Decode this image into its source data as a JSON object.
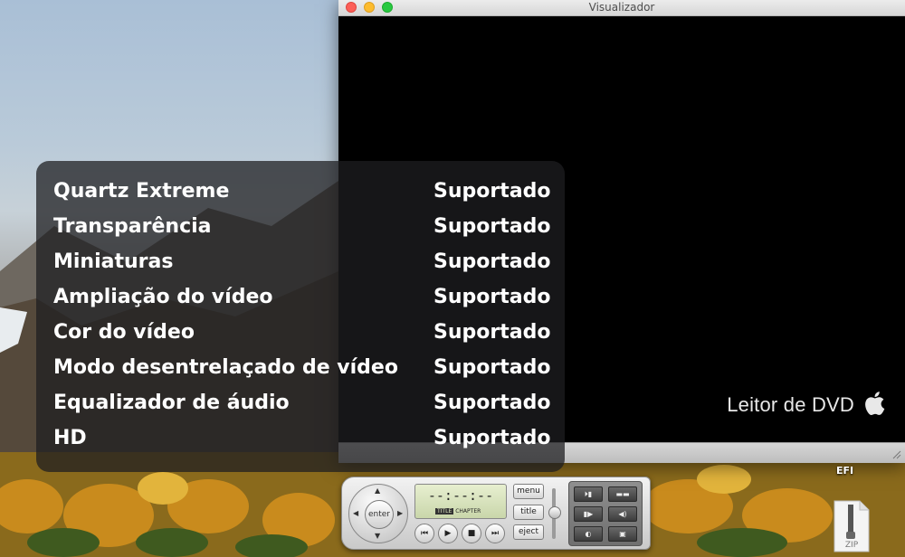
{
  "window": {
    "title": "Visualizador",
    "brand": "Leitor de DVD"
  },
  "capabilities": {
    "rows": [
      {
        "name": "Quartz Extreme",
        "status": "Suportado"
      },
      {
        "name": "Transparência",
        "status": "Suportado"
      },
      {
        "name": "Miniaturas",
        "status": "Suportado"
      },
      {
        "name": "Ampliação do vídeo",
        "status": "Suportado"
      },
      {
        "name": "Cor do vídeo",
        "status": "Suportado"
      },
      {
        "name": "Modo desentrelaçado de vídeo",
        "status": "Suportado"
      },
      {
        "name": "Equalizador de áudio",
        "status": "Suportado"
      },
      {
        "name": "HD",
        "status": "Suportado"
      }
    ]
  },
  "desktop": {
    "efi_label": "EFI",
    "zip_label": "ZIP"
  },
  "controller": {
    "enter_label": "enter",
    "time_display": "--:--:--",
    "title_tag": "TITLE",
    "chapter_tag": "CHAPTER",
    "menu_label": "menu",
    "title_label": "title",
    "eject_label": "eject"
  },
  "colors": {
    "close": "#fc5f57",
    "minimize": "#fdbc2e",
    "zoom": "#28c940"
  }
}
